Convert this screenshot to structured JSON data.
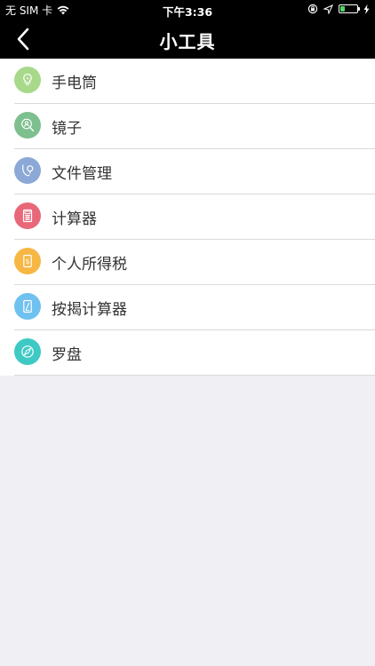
{
  "status_bar": {
    "carrier": "无 SIM 卡",
    "time": "下午3:36",
    "battery_level": 0.3,
    "wifi_icon": "wifi-icon",
    "lock_icon": "orientation-lock-icon",
    "location_icon": "location-arrow-icon",
    "charging_icon": "charging-bolt-icon"
  },
  "nav": {
    "title": "小工具",
    "back_icon": "chevron-left-icon"
  },
  "tools": [
    {
      "label": "手电筒",
      "color": "#a8d98a",
      "icon": "lightbulb-icon"
    },
    {
      "label": "镜子",
      "color": "#7dbf8e",
      "icon": "mirror-icon"
    },
    {
      "label": "文件管理",
      "color": "#8ba8d6",
      "icon": "file-manager-icon"
    },
    {
      "label": "计算器",
      "color": "#e8687a",
      "icon": "calculator-icon"
    },
    {
      "label": "个人所得税",
      "color": "#f7b744",
      "icon": "tax-calculator-icon"
    },
    {
      "label": "按揭计算器",
      "color": "#6fc1ef",
      "icon": "mortgage-calculator-icon"
    },
    {
      "label": "罗盘",
      "color": "#3ec9c5",
      "icon": "compass-icon"
    }
  ]
}
